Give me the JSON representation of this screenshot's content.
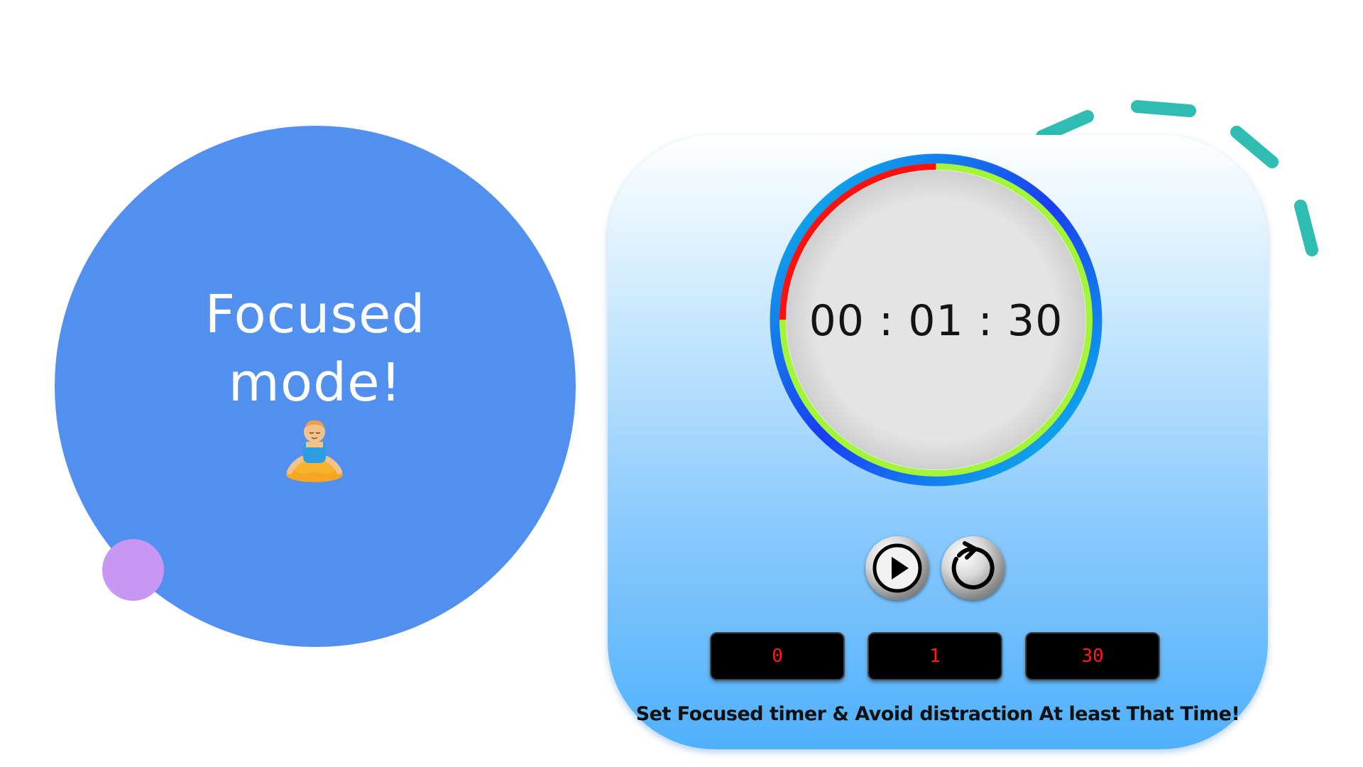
{
  "hero": {
    "title_line1": "Focused",
    "title_line2": "mode!",
    "icon": "person-meditating-emoji"
  },
  "timer": {
    "display": "00 : 01 : 30",
    "progress_elapsed_fraction": 0.25,
    "inputs": {
      "hours": "0",
      "minutes": "1",
      "seconds": "30"
    },
    "play_icon": "play-icon",
    "reset_icon": "reset-icon",
    "tagline": "Set Focused timer & Avoid distraction At least That Time!"
  },
  "colors": {
    "hero_blue": "#5190ef",
    "accent_purple": "#c896f3",
    "deco_teal": "#2ebdb0",
    "progress_remaining": "#a3f53a",
    "progress_elapsed": "#ff1010",
    "input_text": "#ff1a1a"
  }
}
